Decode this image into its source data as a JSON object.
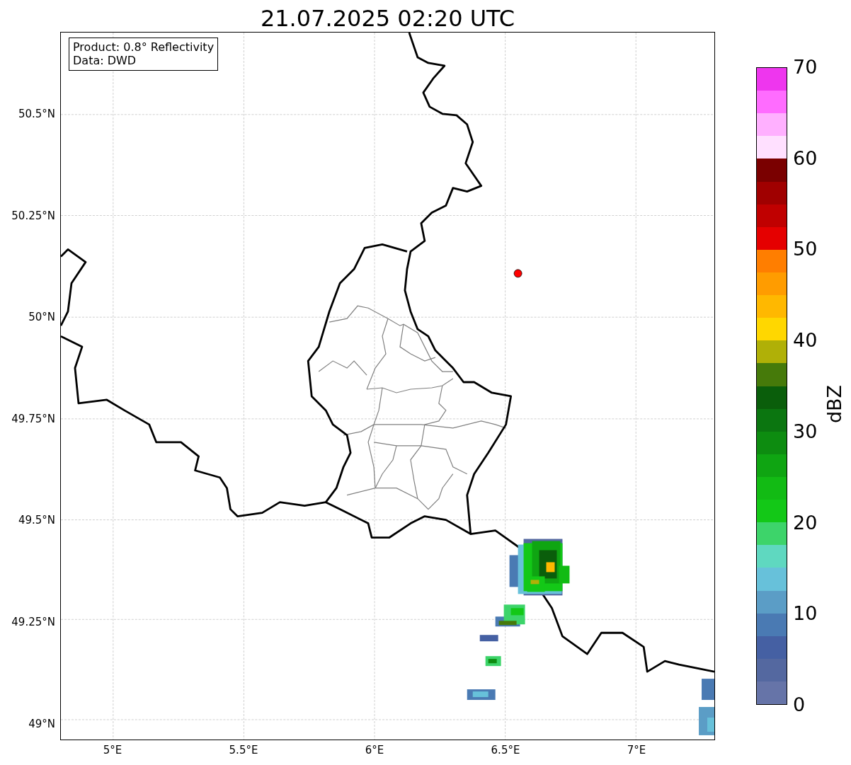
{
  "title": "21.07.2025 02:20 UTC",
  "info_box": {
    "lines": [
      "Product: 0.8° Reflectivity",
      "Data: DWD"
    ]
  },
  "map": {
    "lat_labels": [
      "50.5°N",
      "50.25°N",
      "50°N",
      "49.75°N",
      "49.5°N",
      "49.25°N",
      "49°N"
    ],
    "lon_labels": [
      "5°E",
      "5.5°E",
      "6°E",
      "6.5°E",
      "7°E"
    ]
  },
  "colorbar": {
    "label": "dBZ",
    "ticks": [
      "70",
      "60",
      "50",
      "40",
      "30",
      "20",
      "10",
      "0"
    ],
    "segments": [
      {
        "color": "#ee36ee"
      },
      {
        "color": "#ff6cff"
      },
      {
        "color": "#ffb0ff"
      },
      {
        "color": "#ffe0ff"
      },
      {
        "color": "#7a0000"
      },
      {
        "color": "#a00000"
      },
      {
        "color": "#c00000"
      },
      {
        "color": "#e50000"
      },
      {
        "color": "#ff7e00"
      },
      {
        "color": "#ff9c00"
      },
      {
        "color": "#ffb800"
      },
      {
        "color": "#ffd700"
      },
      {
        "color": "#b0b007"
      },
      {
        "color": "#467a0a"
      },
      {
        "color": "#0a5e0b"
      },
      {
        "color": "#0b7610"
      },
      {
        "color": "#0d8c10"
      },
      {
        "color": "#0fa512"
      },
      {
        "color": "#12bb14"
      },
      {
        "color": "#13c817"
      },
      {
        "color": "#3dd46a"
      },
      {
        "color": "#5fd8c0"
      },
      {
        "color": "#67c1da"
      },
      {
        "color": "#5b9dc6"
      },
      {
        "color": "#4a7ab3"
      },
      {
        "color": "#4560a3"
      },
      {
        "color": "#5468a0"
      },
      {
        "color": "#6674a8"
      }
    ]
  }
}
